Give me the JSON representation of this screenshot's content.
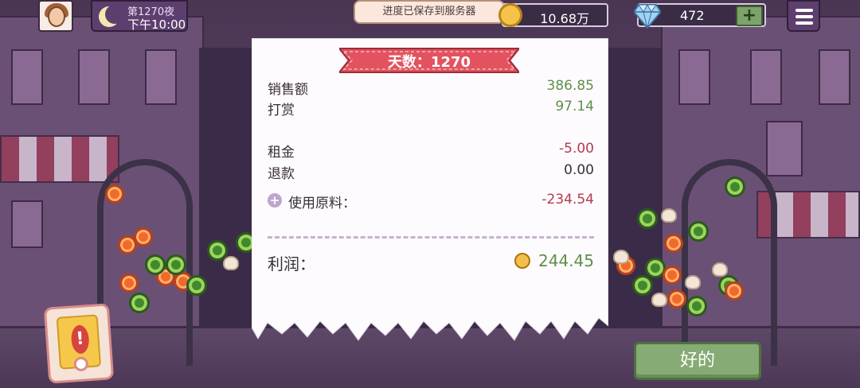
{
  "hud": {
    "day_label": "第1270夜",
    "time_label": "下午10:00",
    "toast": "进度已保存到服务器",
    "coins": "10.68万",
    "gems": "472",
    "gem_plus": "+"
  },
  "receipt": {
    "banner": "天数：1270",
    "rows": [
      {
        "label": "销售额",
        "value": "386.85"
      },
      {
        "label": "打赏",
        "value": "97.14"
      },
      {
        "label": "租金",
        "value": "-5.00"
      },
      {
        "label": "退款",
        "value": "0.00"
      },
      {
        "label": "使用原料：",
        "value": "-234.54"
      }
    ],
    "profit_label": "利润：",
    "profit_value": "244.45"
  },
  "buttons": {
    "ok": "好的",
    "alert_mark": "!"
  },
  "colors": {
    "positive": "#5f8f4a",
    "negative": "#b23b4f",
    "banner": "#e3525f"
  },
  "icons": [
    "moon-icon",
    "coin-icon",
    "diamond-icon",
    "plus-icon",
    "menu-icon",
    "alert-icon",
    "plus-circle-icon"
  ]
}
